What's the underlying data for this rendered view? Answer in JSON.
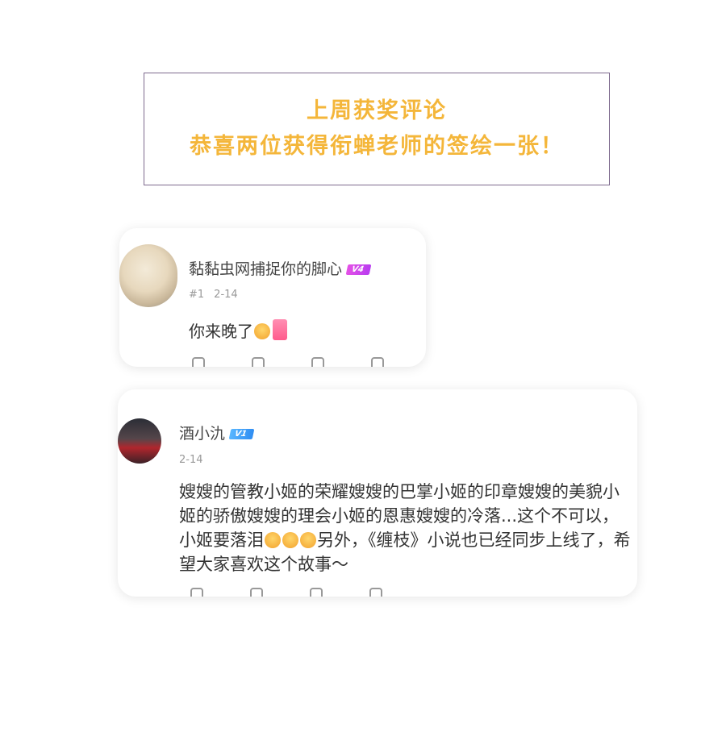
{
  "banner": {
    "line1": "上周获奖评论",
    "line2": "恭喜两位获得衔蝉老师的签绘一张！",
    "text_color": "#f4b63a",
    "border_color": "#7e6a8e"
  },
  "comments": [
    {
      "username": "黏黏虫网捕捉你的脚心",
      "level_badge": "V4",
      "floor": "#1",
      "date": "2-14",
      "text": "你来晚了",
      "emoji": [
        "crying-face-emoji",
        "sticker-emoji"
      ]
    },
    {
      "username": "酒小氿",
      "level_badge": "V1",
      "date": "2-14",
      "text_part1": "嫂嫂的管教小姬的荣耀嫂嫂的巴掌小姬的印章嫂嫂的美貌小姬的骄傲嫂嫂的理会小姬的恩惠嫂嫂的冷落...这个不可以，小姬要落泪",
      "text_part2": "另外，《缠枝》小说也已经同步上线了，希望大家喜欢这个故事～",
      "emoji": [
        "crying-face-emoji",
        "crying-face-emoji",
        "crying-face-emoji"
      ]
    }
  ]
}
